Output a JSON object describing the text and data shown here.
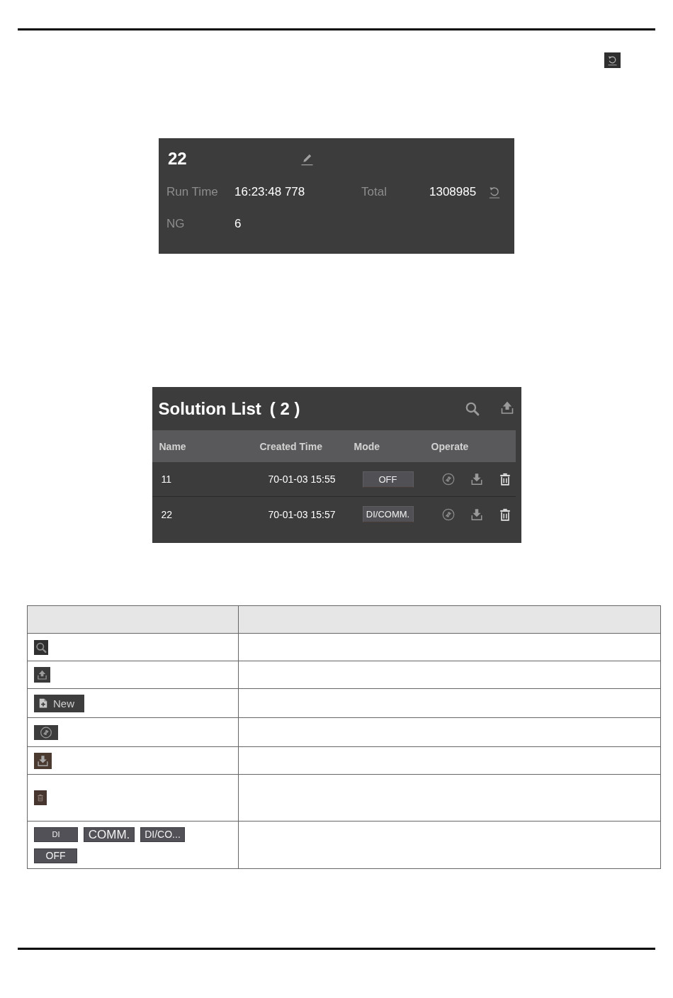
{
  "counter_panel": {
    "title": "22",
    "fields": [
      {
        "label": "Run Time",
        "value": "16:23:48 778"
      },
      {
        "label": "Total",
        "value": "1308985"
      },
      {
        "label": "NG",
        "value": "6"
      }
    ]
  },
  "solution_list": {
    "title": "Solution List",
    "count": "( 2 )",
    "columns": [
      "Name",
      "Created Time",
      "Mode",
      "Operate"
    ],
    "rows": [
      {
        "name": "11",
        "created_time": "70-01-03 15:55",
        "mode": "OFF"
      },
      {
        "name": "22",
        "created_time": "70-01-03 15:57",
        "mode": "DI/COMM."
      }
    ]
  },
  "legend_table": {
    "rows": [
      {
        "kind": "icon"
      },
      {
        "kind": "icon"
      },
      {
        "kind": "button",
        "label": "New"
      },
      {
        "kind": "icon"
      },
      {
        "kind": "icon"
      },
      {
        "kind": "icon"
      },
      {
        "kind": "modes",
        "labels": [
          "DI",
          "COMM.",
          "DI/CO...",
          "OFF"
        ]
      }
    ]
  }
}
